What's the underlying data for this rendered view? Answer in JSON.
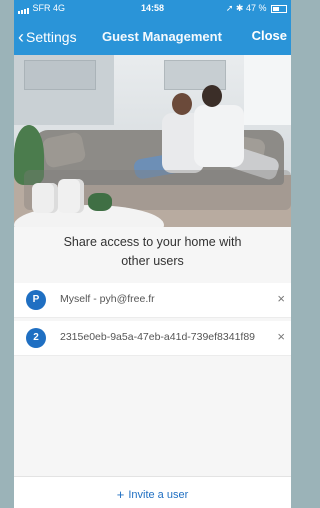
{
  "statusbar": {
    "carrier": "SFR",
    "network": "4G",
    "time": "14:58",
    "battery": "47 %"
  },
  "navbar": {
    "back_label": "Settings",
    "title": "Guest Management",
    "close_label": "Close"
  },
  "hero": {
    "icon": "living-room-photo"
  },
  "share": {
    "line1": "Share access to your home with",
    "line2": "other users"
  },
  "users": [
    {
      "badge": "P",
      "label": "Myself - pyh@free.fr",
      "remove": "×"
    },
    {
      "badge": "2",
      "label": "2315e0eb-9a5a-47eb-a41d-739ef8341f89",
      "remove": "×"
    }
  ],
  "invite": {
    "icon": "+",
    "label": "Invite a user"
  },
  "colors": {
    "accent": "#2a94d8",
    "badge": "#1f6fc2",
    "link": "#1f6fc2"
  }
}
